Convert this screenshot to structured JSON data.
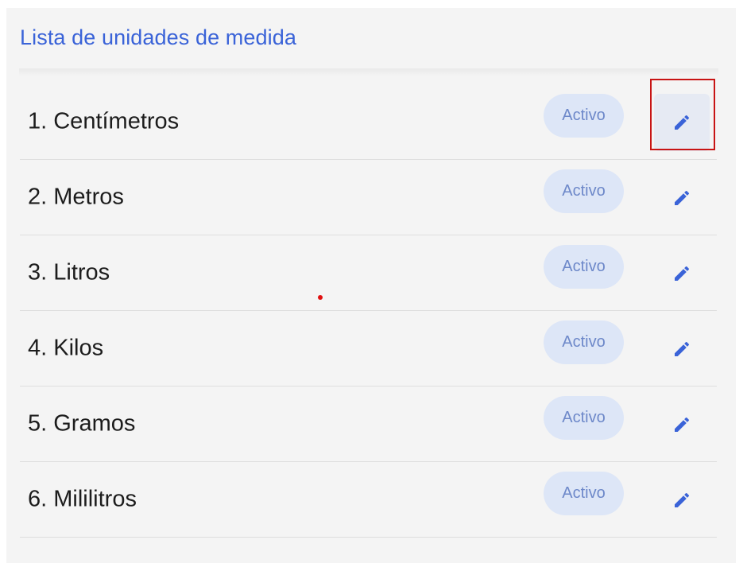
{
  "header": {
    "title": "Lista de unidades de medida"
  },
  "units": [
    {
      "label": "1. Centímetros",
      "status": "Activo"
    },
    {
      "label": "2. Metros",
      "status": "Activo"
    },
    {
      "label": "3. Litros",
      "status": "Activo"
    },
    {
      "label": "4. Kilos",
      "status": "Activo"
    },
    {
      "label": "5. Gramos",
      "status": "Activo"
    },
    {
      "label": "6. Mililitros",
      "status": "Activo"
    }
  ],
  "colors": {
    "accent": "#3a63d8",
    "badge_bg": "#dde6f7",
    "badge_text": "#6d88c9",
    "highlight": "#c81414"
  },
  "icons": {
    "edit": "pencil-icon"
  }
}
